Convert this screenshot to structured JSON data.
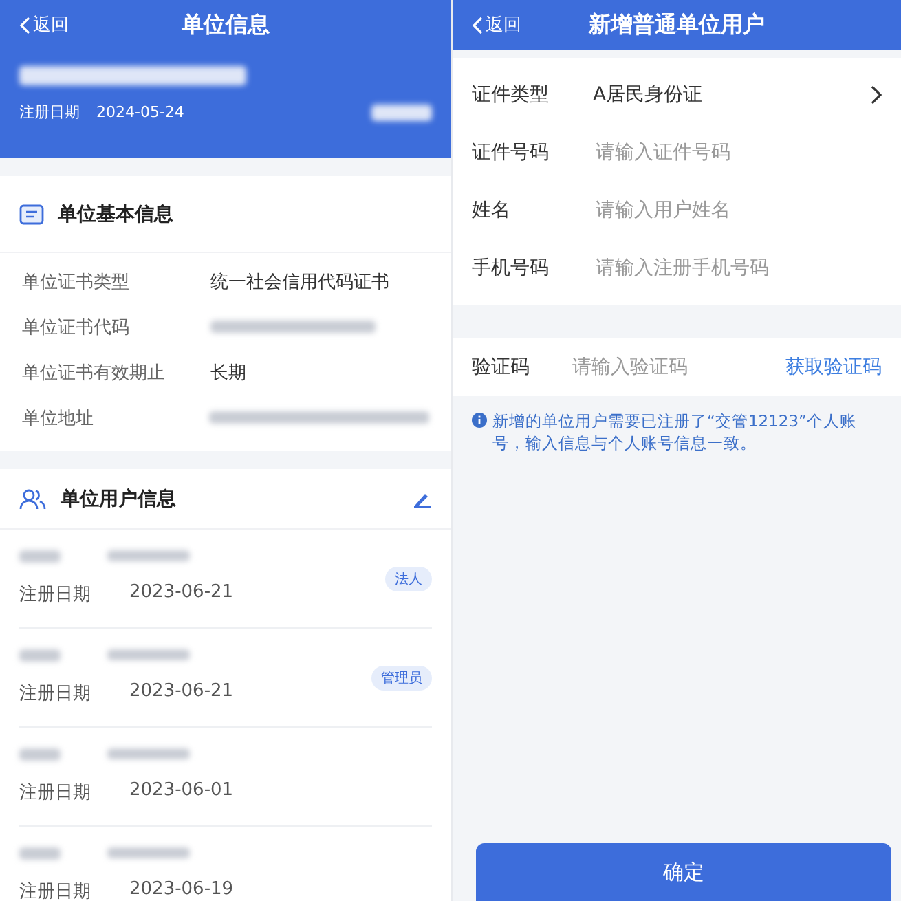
{
  "left": {
    "header": {
      "back": "返回",
      "title": "单位信息",
      "date_label": "注册日期",
      "date": "2024-05-24"
    },
    "basic_info": {
      "title": "单位基本信息",
      "rows": [
        {
          "label": "单位证书类型",
          "value": "统一社会信用代码证书"
        },
        {
          "label": "单位证书代码"
        },
        {
          "label": "单位证书有效期止",
          "value": "长期"
        },
        {
          "label": "单位地址"
        }
      ]
    },
    "users": {
      "title": "单位用户信息",
      "items": [
        {
          "date_label": "注册日期",
          "date": "2023-06-21",
          "role": "法人"
        },
        {
          "date_label": "注册日期",
          "date": "2023-06-21",
          "role": "管理员"
        },
        {
          "date_label": "注册日期",
          "date": "2023-06-01"
        },
        {
          "date_label": "注册日期",
          "date": "2023-06-19"
        }
      ]
    }
  },
  "right": {
    "header": {
      "back": "返回",
      "title": "新增普通单位用户"
    },
    "fields": [
      {
        "kind": "select",
        "label": "证件类型",
        "value": "A居民身份证"
      },
      {
        "kind": "input",
        "label": "证件号码",
        "placeholder": "请输入证件号码"
      },
      {
        "kind": "input",
        "label": "姓名",
        "placeholder": "请输入用户姓名"
      },
      {
        "kind": "input",
        "label": "手机号码",
        "placeholder": "请输入注册手机号码"
      }
    ],
    "verify": {
      "label": "验证码",
      "placeholder": "请输入验证码",
      "action": "获取验证码"
    },
    "note": "新增的单位用户需要已注册了“交管12123”个人账号，输入信息与个人账号信息一致。",
    "confirm": "确定"
  }
}
